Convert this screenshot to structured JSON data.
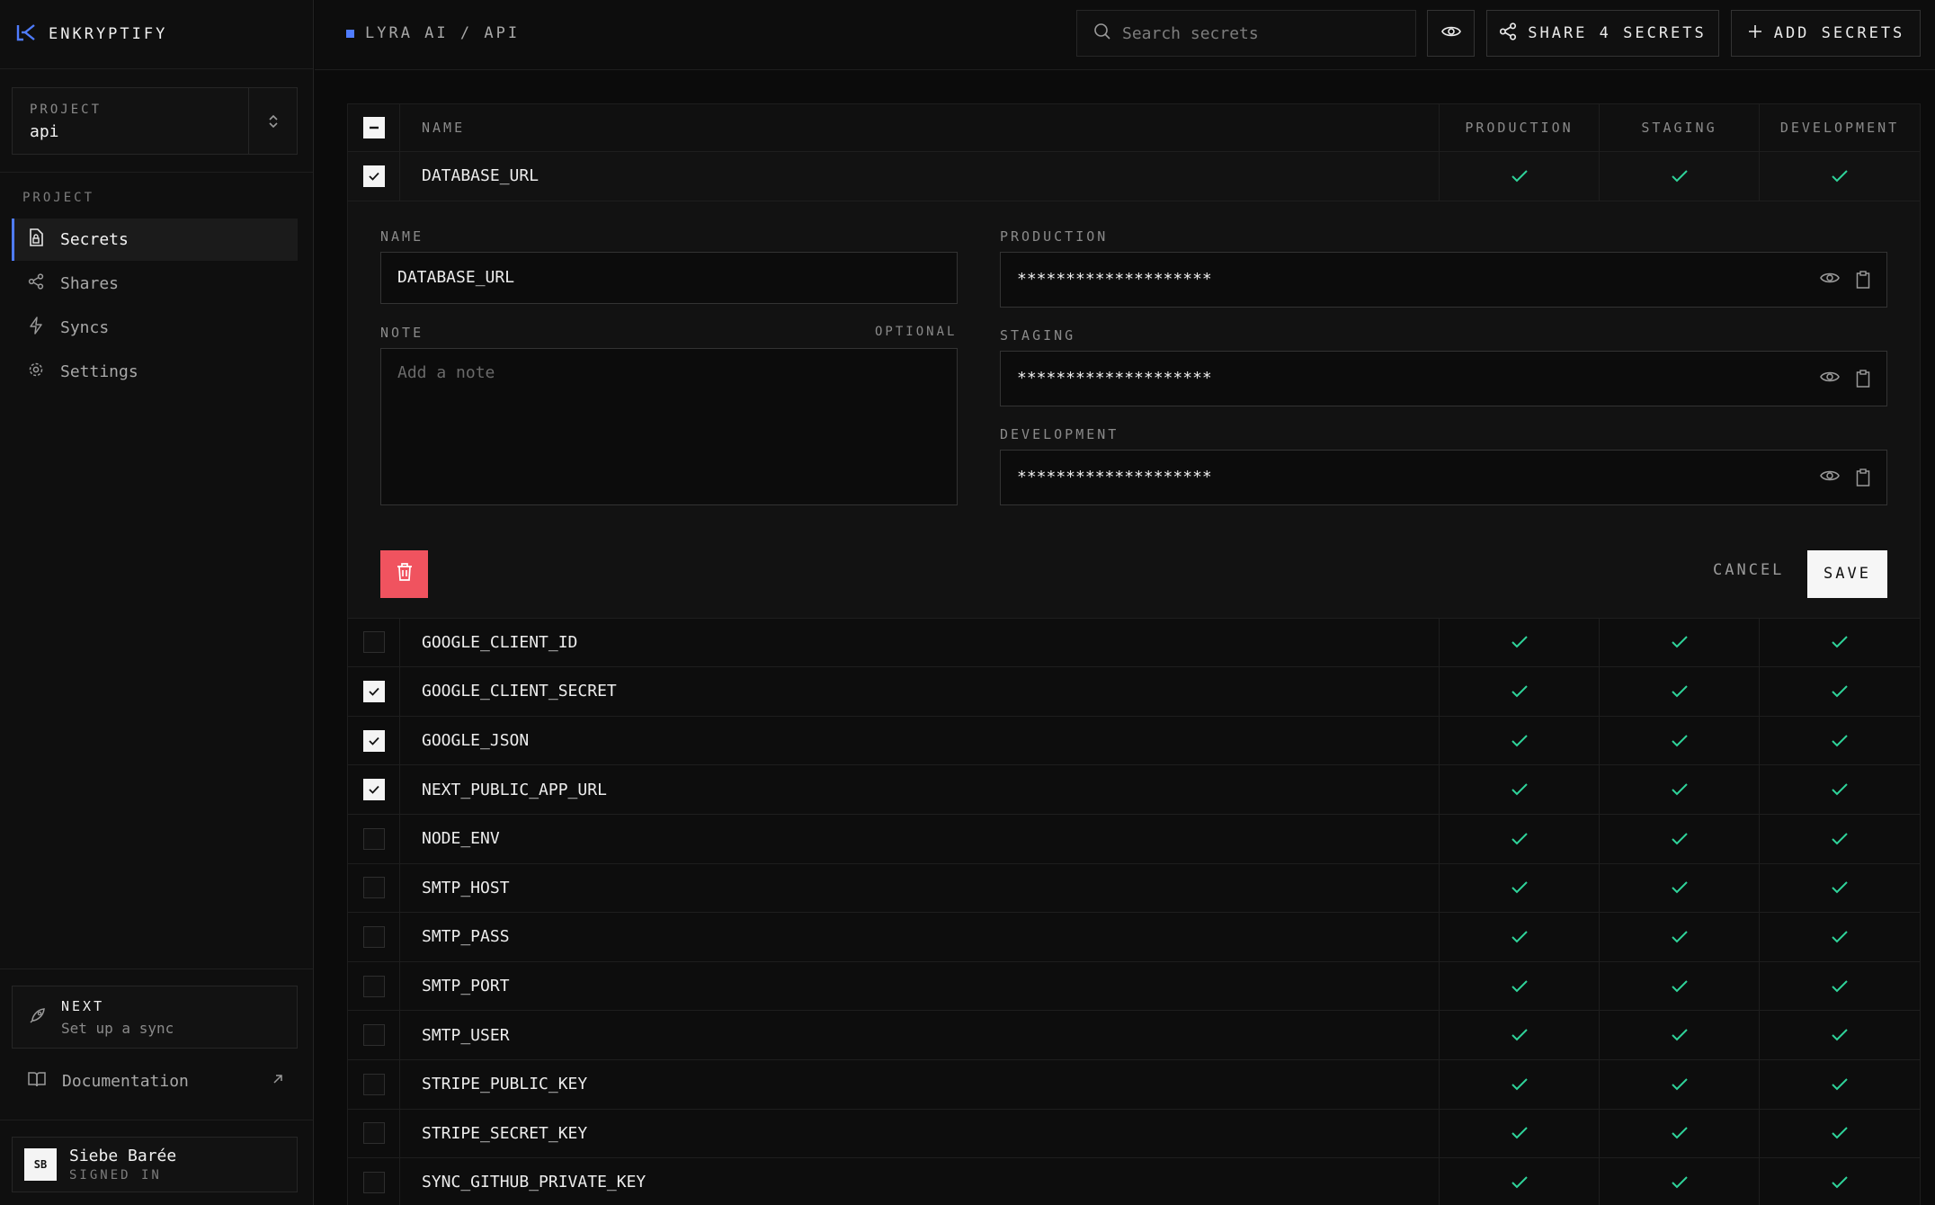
{
  "app": {
    "brand": "ENKRYPTIFY",
    "accent": "#4f7cff"
  },
  "sidebar": {
    "project_label": "PROJECT",
    "project_value": "api",
    "nav_heading": "PROJECT",
    "items": [
      {
        "label": "Secrets",
        "icon": "file-lock-icon",
        "active": true
      },
      {
        "label": "Shares",
        "icon": "share-icon",
        "active": false
      },
      {
        "label": "Syncs",
        "icon": "bolt-icon",
        "active": false
      },
      {
        "label": "Settings",
        "icon": "gear-icon",
        "active": false
      }
    ],
    "next": {
      "title": "NEXT",
      "subtitle": "Set up a sync"
    },
    "docs_label": "Documentation",
    "user": {
      "initials": "SB",
      "name": "Siebe Barée",
      "status": "SIGNED IN"
    }
  },
  "topbar": {
    "breadcrumb": "LYRA AI / API",
    "search_placeholder": "Search secrets",
    "share_label": "SHARE 4 SECRETS",
    "add_label": "ADD SECRETS"
  },
  "table": {
    "headers": {
      "name": "NAME",
      "envs": [
        "PRODUCTION",
        "STAGING",
        "DEVELOPMENT"
      ]
    },
    "expanded_row": {
      "name": "DATABASE_URL",
      "checked": true
    },
    "rows": [
      {
        "name": "GOOGLE_CLIENT_ID",
        "checked": false
      },
      {
        "name": "GOOGLE_CLIENT_SECRET",
        "checked": true
      },
      {
        "name": "GOOGLE_JSON",
        "checked": true
      },
      {
        "name": "NEXT_PUBLIC_APP_URL",
        "checked": true
      },
      {
        "name": "NODE_ENV",
        "checked": false
      },
      {
        "name": "SMTP_HOST",
        "checked": false
      },
      {
        "name": "SMTP_PASS",
        "checked": false
      },
      {
        "name": "SMTP_PORT",
        "checked": false
      },
      {
        "name": "SMTP_USER",
        "checked": false
      },
      {
        "name": "STRIPE_PUBLIC_KEY",
        "checked": false
      },
      {
        "name": "STRIPE_SECRET_KEY",
        "checked": false
      },
      {
        "name": "SYNC_GITHUB_PRIVATE_KEY",
        "checked": false
      }
    ]
  },
  "editor": {
    "name_label": "NAME",
    "name_value": "DATABASE_URL",
    "note_label": "NOTE",
    "note_optional": "OPTIONAL",
    "note_placeholder": "Add a note",
    "env_fields": [
      {
        "label": "PRODUCTION",
        "masked": "********************"
      },
      {
        "label": "STAGING",
        "masked": "********************"
      },
      {
        "label": "DEVELOPMENT",
        "masked": "********************"
      }
    ],
    "cancel_label": "CANCEL",
    "save_label": "SAVE",
    "delete_color": "#f0535f"
  },
  "colors": {
    "check": "#2fd39a",
    "background": "#0b0b0b"
  }
}
